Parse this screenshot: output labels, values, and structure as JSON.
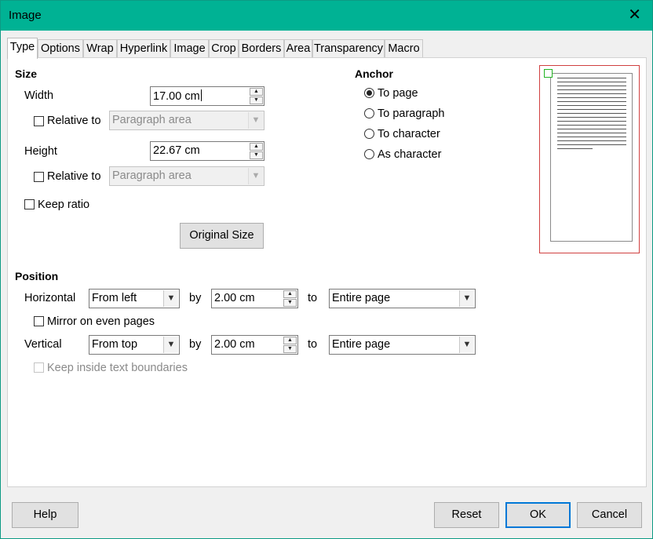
{
  "window": {
    "title": "Image"
  },
  "tabs": [
    "Type",
    "Options",
    "Wrap",
    "Hyperlink",
    "Image",
    "Crop",
    "Borders",
    "Area",
    "Transparency",
    "Macro"
  ],
  "size": {
    "heading": "Size",
    "width_label": "Width",
    "width_value": "17.00 cm",
    "relative_label": "Relative to",
    "relative_value": "Paragraph area",
    "height_label": "Height",
    "height_value": "22.67 cm",
    "keep_ratio_label": "Keep ratio",
    "original_size_label": "Original Size"
  },
  "anchor": {
    "heading": "Anchor",
    "options": [
      "To page",
      "To paragraph",
      "To character",
      "As character"
    ],
    "selected": "To page"
  },
  "position": {
    "heading": "Position",
    "horizontal_label": "Horizontal",
    "horizontal_value": "From left",
    "by_label": "by",
    "horizontal_by": "2.00 cm",
    "to_label": "to",
    "horizontal_to": "Entire page",
    "mirror_label": "Mirror on even pages",
    "vertical_label": "Vertical",
    "vertical_value": "From top",
    "vertical_by": "2.00 cm",
    "vertical_to": "Entire page",
    "keep_inside_label": "Keep inside text boundaries"
  },
  "buttons": {
    "help": "Help",
    "reset": "Reset",
    "ok": "OK",
    "cancel": "Cancel"
  },
  "icons": {
    "close": "close-icon",
    "spin_up": "chevron-up-icon",
    "spin_down": "chevron-down-icon",
    "dropdown": "chevron-down-icon"
  },
  "colors": {
    "titlebar": "#00b294",
    "preview_border": "#d04040",
    "anchor_marker": "#22b422",
    "default_button": "#0078d7"
  }
}
